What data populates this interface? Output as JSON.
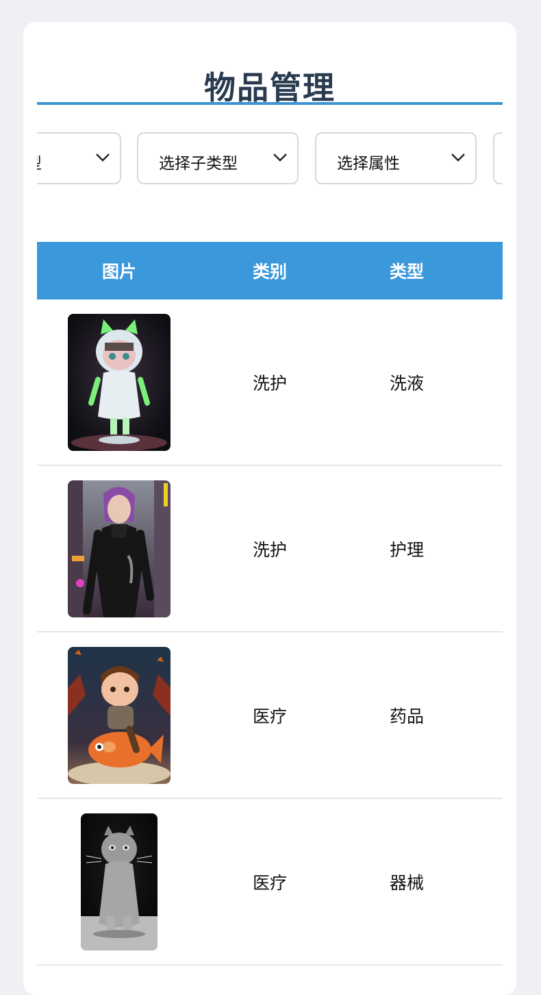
{
  "page": {
    "title": "物品管理"
  },
  "filters": [
    {
      "label": "选择类型",
      "visible_text": "型"
    },
    {
      "label": "选择子类型"
    },
    {
      "label": "选择属性"
    },
    {
      "label": ""
    }
  ],
  "table": {
    "headers": [
      "图片",
      "类别",
      "类型"
    ],
    "rows": [
      {
        "image": "doll-figure-image",
        "category": "洗护",
        "type": "洗液"
      },
      {
        "image": "girl-in-black-suit-image",
        "category": "洗护",
        "type": "护理"
      },
      {
        "image": "boy-riding-fish-image",
        "category": "医疗",
        "type": "药品"
      },
      {
        "image": "gray-cat-image",
        "category": "医疗",
        "type": "器械"
      }
    ]
  },
  "colors": {
    "accent": "#3a98db",
    "title": "#2a3b4f",
    "background": "#eef0f4"
  }
}
